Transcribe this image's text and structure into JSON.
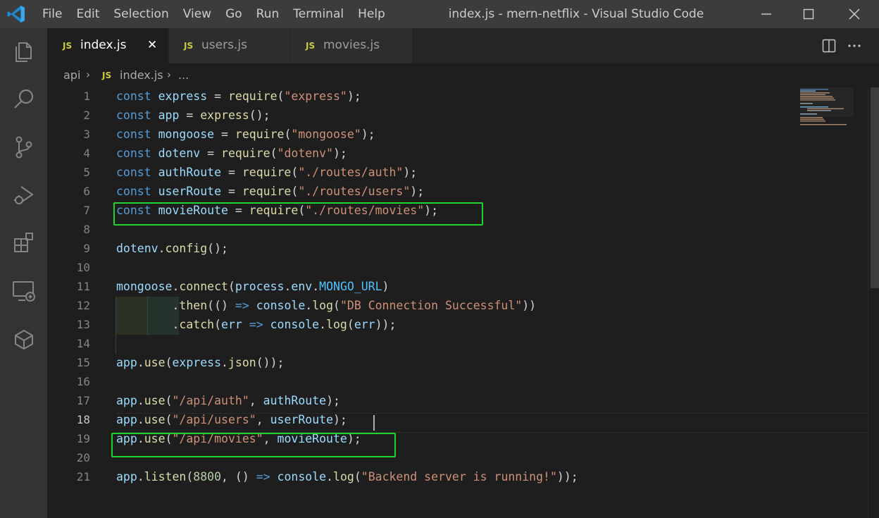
{
  "titlebar": {
    "menu": [
      "File",
      "Edit",
      "Selection",
      "View",
      "Go",
      "Run",
      "Terminal",
      "Help"
    ],
    "title": "index.js - mern-netflix - Visual Studio Code"
  },
  "activity_bar": {
    "items": [
      "explorer-icon",
      "search-icon",
      "source-control-icon",
      "run-debug-icon",
      "extensions-icon",
      "remote-explorer-icon",
      "docker-icon"
    ]
  },
  "tabs": [
    {
      "badge": "JS",
      "label": "index.js",
      "active": true,
      "close": "✕"
    },
    {
      "badge": "JS",
      "label": "users.js",
      "active": false
    },
    {
      "badge": "JS",
      "label": "movies.js",
      "active": false
    }
  ],
  "breadcrumb": {
    "folder": "api",
    "badge": "JS",
    "file": "index.js",
    "symbol": "..."
  },
  "editor": {
    "language": "javascript",
    "active_line": 18,
    "highlighted_lines": [
      7,
      19
    ],
    "lines": [
      "const express = require(\"express\");",
      "const app = express();",
      "const mongoose = require(\"mongoose\");",
      "const dotenv = require(\"dotenv\");",
      "const authRoute = require(\"./routes/auth\");",
      "const userRoute = require(\"./routes/users\");",
      "const movieRoute = require(\"./routes/movies\");",
      "",
      "dotenv.config();",
      "",
      "mongoose.connect(process.env.MONGO_URL)",
      "        .then(() => console.log(\"DB Connection Successful\"))",
      "        .catch(err => console.log(err));",
      "",
      "app.use(express.json());",
      "",
      "app.use(\"/api/auth\", authRoute);",
      "app.use(\"/api/users\", userRoute);",
      "app.use(\"/api/movies\", movieRoute);",
      "",
      "app.listen(8800, () => console.log(\"Backend server is running!\"));"
    ]
  },
  "colors": {
    "titlebar": "#3c3c3c",
    "activitybar": "#333333",
    "editor_bg": "#1e1e1e",
    "highlight_box": "#21d42c",
    "keyword": "#569cd6",
    "string": "#ce9178",
    "function": "#dcdcaa",
    "variable": "#9cdcfe",
    "constant": "#4fc1ff",
    "number": "#b5cea8",
    "js_badge": "#cbcb41"
  }
}
